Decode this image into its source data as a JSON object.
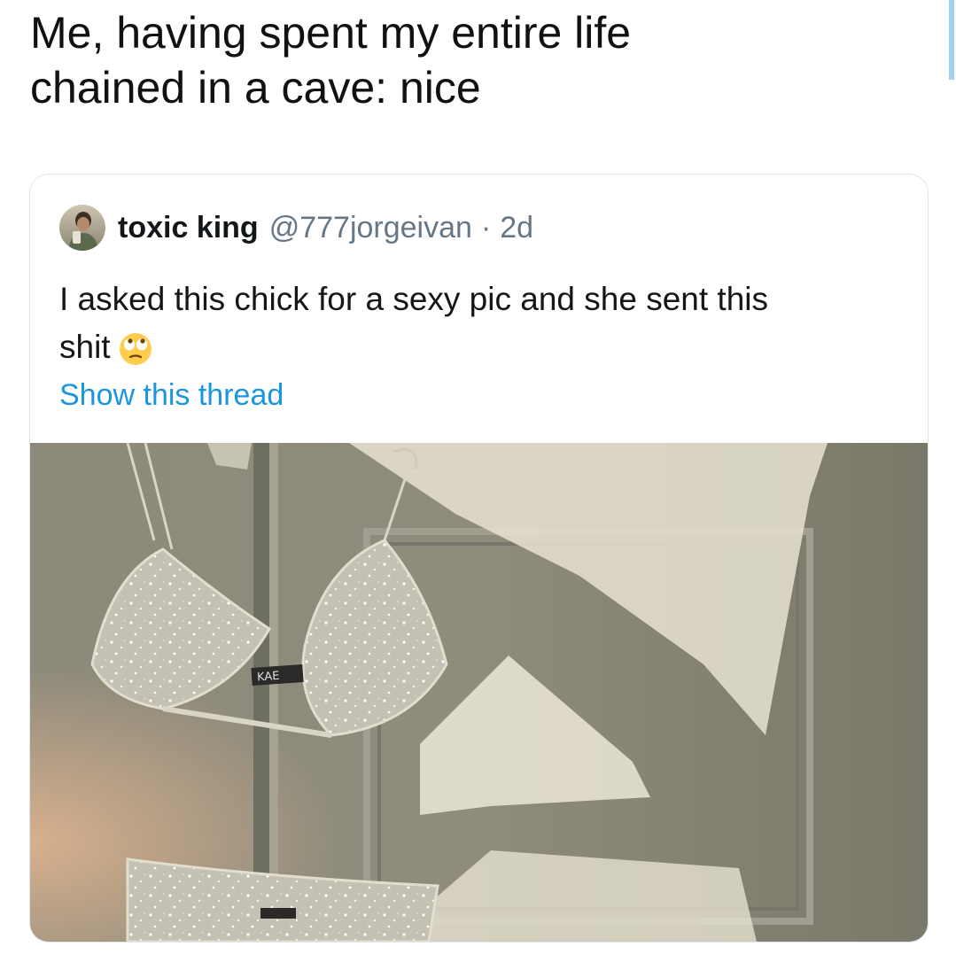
{
  "caption": {
    "line1": "Me, having spent my entire life",
    "line2": "chained in a cave: nice"
  },
  "quoted_tweet": {
    "display_name": "toxic king",
    "handle": "@777jorgeivan",
    "separator": "·",
    "time": "2d",
    "text_line1": "I asked this chick for a sexy pic and she sent this",
    "text_line2": "shit",
    "emoji": "rolling-eyes-emoji",
    "thread_link": "Show this thread",
    "media_label": "KAE"
  },
  "colors": {
    "link": "#1b95e0",
    "secondary_text": "#657786",
    "primary_text": "#14171a",
    "card_border": "#dfe6ea",
    "scroll_indicator": "#9fd0ee"
  }
}
